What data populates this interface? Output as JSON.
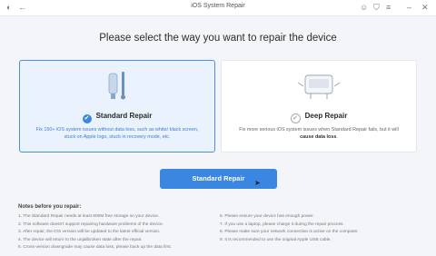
{
  "window": {
    "title": "iOS System Repair"
  },
  "heading": "Please select the way you want to repair the device",
  "cards": [
    {
      "title": "Standard Repair",
      "desc": "Fix 150+ iOS system issues without data loss, such as white/ black screen, stuck on Apple logo, stuck in recovery mode, etc."
    },
    {
      "title": "Deep Repair",
      "desc_pre": "Fix more serious iOS system issues when Standard Repair fails, but it will ",
      "desc_bold": "cause data loss",
      "desc_post": "."
    }
  ],
  "primary_button": "Standard Repair",
  "notes": {
    "title": "Notes before you repair:",
    "left": [
      "1. The Standard Repair needs at least 800M free storage on your device.",
      "2. This software doesn't support repairing hardware problems of the device.",
      "3. After repair, the iOS version will be updated to the latest official version.",
      "4. The device will return to the unjailbroken state after the repair.",
      "5. Cross-version downgrade may cause data loss, please back up the data first."
    ],
    "right": [
      "6. Please ensure your device has enough power.",
      "7. If you use a laptop, please charge it during the repair process.",
      "8. Please make sure your network connection is active on the computer.",
      "9. It is recommended to use the original Apple USB cable."
    ]
  },
  "colors": {
    "accent": "#3a86e0",
    "card_selected_bg": "#eaf3fd",
    "page_bg": "#f3f5f9"
  }
}
